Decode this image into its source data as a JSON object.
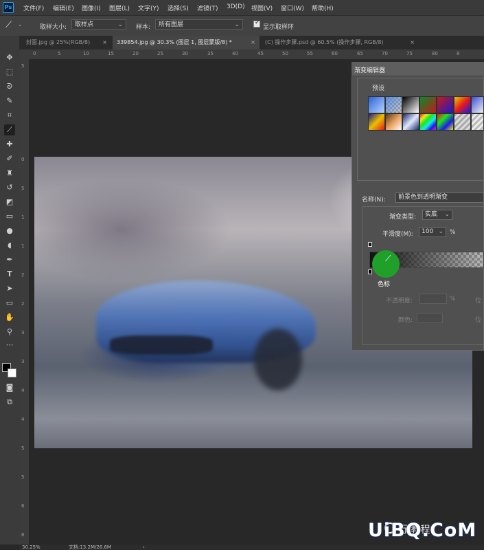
{
  "app": {
    "logo": "Ps"
  },
  "menubar": {
    "items": [
      "文件(F)",
      "编辑(E)",
      "图像(I)",
      "图层(L)",
      "文字(Y)",
      "选择(S)",
      "滤镜(T)",
      "3D(D)",
      "视图(V)",
      "窗口(W)",
      "帮助(H)"
    ]
  },
  "options": {
    "sample_size_label": "取样大小:",
    "sample_size_value": "取样点",
    "sample_label": "样本:",
    "sample_value": "所有图层",
    "show_ring_label": "显示取样环",
    "show_ring_checked": true
  },
  "tabs": [
    {
      "label": "封面.jpg @ 25%(RGB/8)",
      "close": "×",
      "active": false
    },
    {
      "label": "339854.jpg @ 30.3% (图层 1, 图层蒙版/8) *",
      "close": "×",
      "active": true
    },
    {
      "label": "(C) 操作步骤.psd @ 60.5% (操作步骤, RGB/8)",
      "close": "×",
      "active": false
    }
  ],
  "ruler_top_ticks": [
    "0",
    "5",
    "10",
    "15",
    "20",
    "25",
    "30",
    "35",
    "40",
    "45",
    "50",
    "55",
    "60",
    "65",
    "70",
    "75",
    "80",
    "8"
  ],
  "ruler_left_ticks": [
    "5",
    "0",
    "5",
    "1",
    "1",
    "2",
    "2",
    "3",
    "3",
    "4",
    "4",
    "5",
    "5",
    "6",
    "6"
  ],
  "gradient_editor": {
    "title": "渐变编辑器",
    "presets_label": "预设",
    "name_label": "名称(N):",
    "name_value": "前景色到透明渐变",
    "type_label": "渐变类型:",
    "type_value": "实底",
    "smoothness_label": "平滑度(M):",
    "smoothness_value": "100",
    "smoothness_unit": "%",
    "stops_label": "色标",
    "opacity_label": "不透明度:",
    "opacity_unit": "%",
    "color_label": "颜色:",
    "location_label_1": "位",
    "location_label_2": "位"
  },
  "status": {
    "zoom": "30.25%",
    "doc": "文档:13.2M/26.6M",
    "arrow": "›"
  },
  "watermark": {
    "text": "UiBQ.CoM",
    "sub": "行 教程"
  },
  "colors": {
    "accent": "#31a8ff",
    "highlight_stop": "#20a02a",
    "foreground": "#000000",
    "background": "#ffffff"
  }
}
